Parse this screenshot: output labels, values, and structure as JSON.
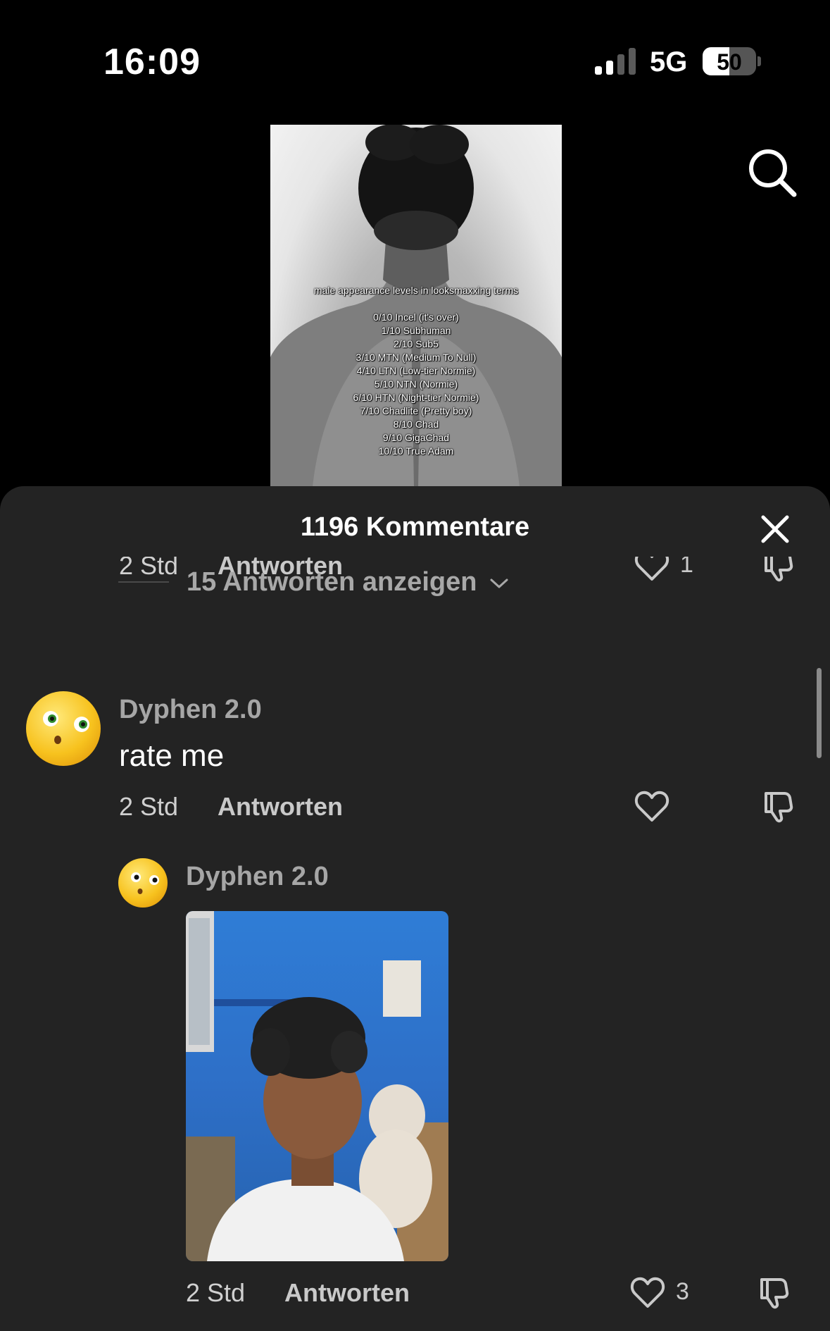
{
  "status_bar": {
    "time": "16:09",
    "network": "5G",
    "battery_percent": "50",
    "battery_level": 0.5
  },
  "video": {
    "overlay_title": "male appearance levels in looksmaxxing terms",
    "overlay_lines": [
      "0/10 Incel (it's over)",
      "1/10 Subhuman",
      "2/10 Sub5",
      "3/10 MTN (Medium To Null)",
      "4/10 LTN (Low-tier Normie)",
      "5/10 NTN (Normie)",
      "6/10 HTN (Night-tier Normie)",
      "7/10 Chadlite (Pretty boy)",
      "8/10 Chad",
      "9/10 GigaChad",
      "10/10 True Adam"
    ]
  },
  "comments_sheet": {
    "title": "1196 Kommentare",
    "partial_comment": {
      "time": "2 Std",
      "reply_label": "Antworten",
      "like_count": "1"
    },
    "show_replies_label": "15 Antworten anzeigen",
    "comment": {
      "username": "Dyphen 2.0",
      "text": "rate me",
      "time": "2 Std",
      "reply_label": "Antworten"
    },
    "reply": {
      "username": "Dyphen 2.0",
      "time": "2 Std",
      "reply_label": "Antworten",
      "like_count": "3"
    }
  },
  "colors": {
    "sheet_background": "#232323",
    "muted_text": "#a6a6a6",
    "accent_text": "#ffffff"
  },
  "icons": [
    "search-icon",
    "close-icon",
    "heart-icon",
    "thumbs-down-icon",
    "chevron-down-icon",
    "signal-icon",
    "battery-icon"
  ]
}
